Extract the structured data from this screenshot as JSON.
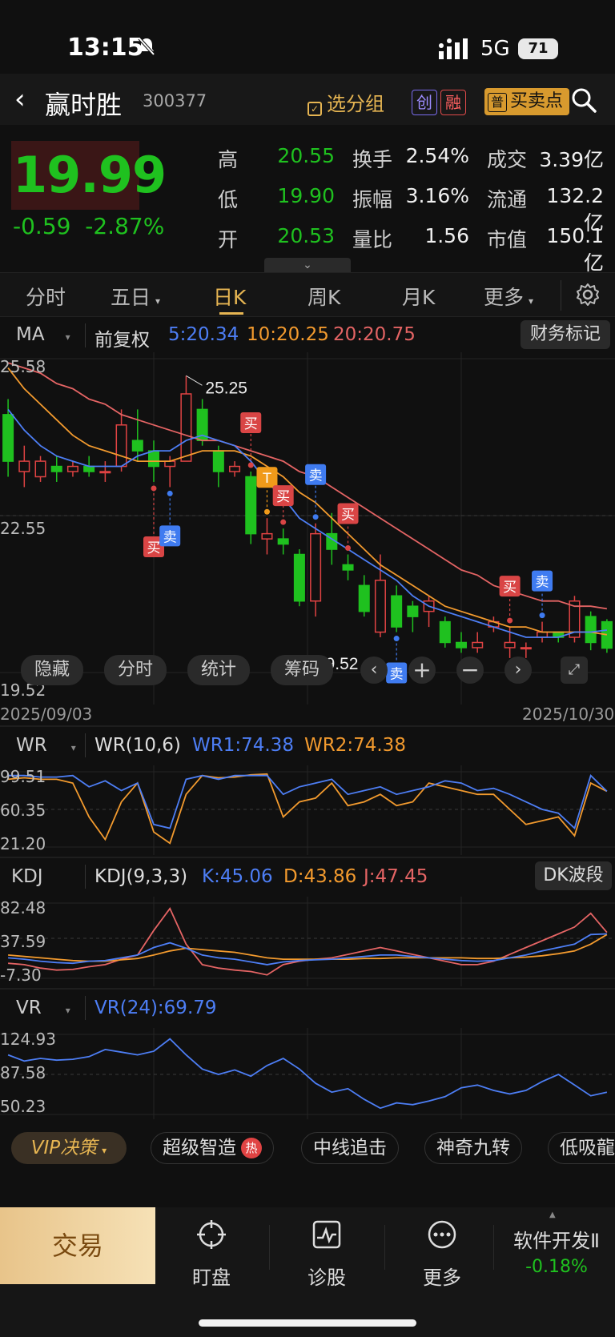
{
  "status_bar": {
    "time": "13:15",
    "network": "5G",
    "battery": "71"
  },
  "header": {
    "stock_name": "赢时胜",
    "stock_code": "300377",
    "group_button": "选分组",
    "tag_chuang": "创",
    "tag_rong": "融",
    "tag_pu": "普",
    "buy_sell_points": "买卖点"
  },
  "quote": {
    "price": "19.99",
    "change": "-0.59",
    "change_pct": "-2.87%",
    "high_label": "高",
    "high": "20.55",
    "low_label": "低",
    "low": "19.90",
    "open_label": "开",
    "open": "20.53",
    "turnover_label": "换手",
    "turnover": "2.54%",
    "amplitude_label": "振幅",
    "amplitude": "3.16%",
    "volume_ratio_label": "量比",
    "volume_ratio": "1.56",
    "amount_label": "成交",
    "amount": "3.39亿",
    "float_label": "流通",
    "float_cap": "132.2亿",
    "mktcap_label": "市值",
    "mktcap": "150.1亿"
  },
  "tabs": [
    "分时",
    "五日",
    "日K",
    "周K",
    "月K",
    "更多"
  ],
  "ma_bar": {
    "indicator": "MA",
    "adjust": "前复权",
    "ma5": "5:20.34",
    "ma10": "10:20.25",
    "ma20": "20:20.75",
    "financial_mark": "财务标记"
  },
  "chart_tools": [
    "隐藏",
    "分时",
    "统计",
    "筹码"
  ],
  "kline_axis": {
    "top": "25.58",
    "mid": "22.55",
    "bottom": "19.52",
    "start_date": "2025/09/03",
    "end_date": "2025/10/30",
    "high_mark": "25.25",
    "low_mark": "19.52"
  },
  "signals": {
    "buy": "买",
    "sell": "卖",
    "t": "T"
  },
  "wr": {
    "name": "WR",
    "params": "WR(10,6)",
    "wr1": "WR1:74.38",
    "wr2": "WR2:74.38",
    "ticks": [
      "99.51",
      "60.35",
      "21.20"
    ]
  },
  "kdj": {
    "name": "KDJ",
    "params": "KDJ(9,3,3)",
    "k": "K:45.06",
    "d": "D:43.86",
    "j": "J:47.45",
    "ticks": [
      "82.48",
      "37.59",
      "-7.30"
    ],
    "button": "DK波段"
  },
  "vr": {
    "name": "VR",
    "params": "VR(24):69.79",
    "ticks": [
      "124.93",
      "87.58",
      "50.23"
    ]
  },
  "strategy_chips": {
    "vip": "VIP决策",
    "items": [
      "超级智造",
      "中线追击",
      "神奇九转",
      "低吸龍"
    ],
    "hot": "热"
  },
  "bottom_nav": {
    "trade": "交易",
    "items": [
      "盯盘",
      "诊股",
      "更多"
    ],
    "sector_name": "软件开发Ⅱ",
    "sector_change": "-0.18%"
  },
  "colors": {
    "up": "#e04343",
    "down": "#1fc11f",
    "ma5": "#4d7ef5",
    "ma10": "#f29a2e",
    "ma20": "#e46464",
    "gold": "#e6b552"
  },
  "chart_data": {
    "type": "candlestick",
    "title": "",
    "y_range": [
      19.52,
      25.58
    ],
    "candles": [
      {
        "o": 24.5,
        "c": 23.6,
        "h": 24.8,
        "l": 23.3
      },
      {
        "o": 23.4,
        "c": 23.6,
        "h": 23.9,
        "l": 23.1
      },
      {
        "o": 23.3,
        "c": 23.6,
        "h": 23.7,
        "l": 23.2
      },
      {
        "o": 23.5,
        "c": 23.4,
        "h": 23.7,
        "l": 23.2
      },
      {
        "o": 23.4,
        "c": 23.5,
        "h": 23.6,
        "l": 23.3
      },
      {
        "o": 23.5,
        "c": 23.4,
        "h": 23.7,
        "l": 23.3
      },
      {
        "o": 23.4,
        "c": 23.4,
        "h": 23.6,
        "l": 23.2
      },
      {
        "o": 23.5,
        "c": 24.3,
        "h": 24.6,
        "l": 23.4
      },
      {
        "o": 24.0,
        "c": 23.8,
        "h": 24.6,
        "l": 23.6
      },
      {
        "o": 23.8,
        "c": 23.5,
        "h": 24.0,
        "l": 23.2
      },
      {
        "o": 23.5,
        "c": 23.6,
        "h": 23.7,
        "l": 23.1
      },
      {
        "o": 23.6,
        "c": 24.9,
        "h": 25.25,
        "l": 23.6
      },
      {
        "o": 24.6,
        "c": 24.0,
        "h": 24.8,
        "l": 23.9
      },
      {
        "o": 23.8,
        "c": 23.4,
        "h": 23.9,
        "l": 23.1
      },
      {
        "o": 23.4,
        "c": 23.5,
        "h": 23.6,
        "l": 23.3
      },
      {
        "o": 23.3,
        "c": 22.2,
        "h": 23.4,
        "l": 22.0
      },
      {
        "o": 22.1,
        "c": 22.2,
        "h": 22.5,
        "l": 21.8
      },
      {
        "o": 22.1,
        "c": 22.0,
        "h": 22.3,
        "l": 21.8
      },
      {
        "o": 21.8,
        "c": 20.9,
        "h": 21.9,
        "l": 20.8
      },
      {
        "o": 20.9,
        "c": 22.2,
        "h": 22.4,
        "l": 20.6
      },
      {
        "o": 22.2,
        "c": 21.9,
        "h": 22.6,
        "l": 21.6
      },
      {
        "o": 21.6,
        "c": 21.5,
        "h": 21.8,
        "l": 21.3
      },
      {
        "o": 21.2,
        "c": 20.7,
        "h": 21.4,
        "l": 20.6
      },
      {
        "o": 20.3,
        "c": 21.3,
        "h": 21.8,
        "l": 20.2
      },
      {
        "o": 21.0,
        "c": 20.4,
        "h": 21.2,
        "l": 20.3
      },
      {
        "o": 20.8,
        "c": 20.6,
        "h": 20.9,
        "l": 20.3
      },
      {
        "o": 20.7,
        "c": 20.9,
        "h": 21.0,
        "l": 20.4
      },
      {
        "o": 20.5,
        "c": 20.1,
        "h": 20.6,
        "l": 20.0
      },
      {
        "o": 20.1,
        "c": 20.0,
        "h": 20.3,
        "l": 19.9
      },
      {
        "o": 20.0,
        "c": 20.1,
        "h": 20.3,
        "l": 19.9
      },
      {
        "o": 20.4,
        "c": 20.5,
        "h": 20.6,
        "l": 20.3
      },
      {
        "o": 20.0,
        "c": 20.1,
        "h": 20.4,
        "l": 19.8
      },
      {
        "o": 20.0,
        "c": 20.0,
        "h": 20.1,
        "l": 19.8
      },
      {
        "o": 20.2,
        "c": 20.3,
        "h": 20.5,
        "l": 20.1
      },
      {
        "o": 20.3,
        "c": 20.2,
        "h": 20.3,
        "l": 20.1
      },
      {
        "o": 20.2,
        "c": 20.9,
        "h": 21.0,
        "l": 20.1
      },
      {
        "o": 20.6,
        "c": 20.1,
        "h": 20.7,
        "l": 19.95
      },
      {
        "o": 20.5,
        "c": 19.99,
        "h": 20.55,
        "l": 19.9
      }
    ],
    "ma5": [
      24.6,
      24.2,
      23.9,
      23.7,
      23.6,
      23.5,
      23.5,
      23.5,
      23.7,
      23.8,
      23.8,
      24.0,
      24.1,
      24.0,
      23.9,
      23.6,
      23.2,
      22.9,
      22.5,
      22.3,
      22.1,
      21.9,
      21.7,
      21.5,
      21.3,
      21.0,
      20.8,
      20.7,
      20.6,
      20.5,
      20.4,
      20.3,
      20.2,
      20.2,
      20.2,
      20.3,
      20.3,
      20.34
    ],
    "ma10": [
      25.4,
      25.0,
      24.7,
      24.4,
      24.1,
      23.9,
      23.8,
      23.7,
      23.6,
      23.6,
      23.6,
      23.7,
      23.8,
      23.8,
      23.8,
      23.7,
      23.5,
      23.3,
      23.0,
      22.8,
      22.5,
      22.2,
      21.9,
      21.6,
      21.4,
      21.2,
      21.0,
      20.8,
      20.7,
      20.6,
      20.5,
      20.4,
      20.4,
      20.3,
      20.3,
      20.3,
      20.3,
      20.25
    ],
    "ma20": [
      25.5,
      25.4,
      25.3,
      25.1,
      25.0,
      24.8,
      24.7,
      24.5,
      24.4,
      24.3,
      24.2,
      24.1,
      24.0,
      24.0,
      23.9,
      23.8,
      23.7,
      23.6,
      23.4,
      23.3,
      23.1,
      22.9,
      22.7,
      22.5,
      22.3,
      22.1,
      21.9,
      21.7,
      21.5,
      21.4,
      21.2,
      21.1,
      21.0,
      20.9,
      20.9,
      20.8,
      20.8,
      20.75
    ],
    "wr1": [
      95,
      95,
      93,
      93,
      95,
      80,
      88,
      75,
      85,
      30,
      25,
      90,
      95,
      90,
      95,
      95,
      95,
      70,
      80,
      85,
      90,
      70,
      75,
      80,
      70,
      75,
      80,
      88,
      85,
      75,
      78,
      70,
      60,
      50,
      45,
      25,
      95,
      74
    ],
    "wr2": [
      90,
      92,
      90,
      90,
      85,
      40,
      10,
      60,
      85,
      20,
      5,
      70,
      95,
      92,
      93,
      96,
      97,
      40,
      60,
      65,
      85,
      55,
      60,
      70,
      55,
      60,
      85,
      80,
      75,
      70,
      70,
      50,
      30,
      35,
      40,
      15,
      85,
      74
    ],
    "kdj_k": [
      10,
      8,
      5,
      3,
      2,
      5,
      6,
      10,
      14,
      25,
      32,
      24,
      14,
      10,
      8,
      4,
      0,
      4,
      6,
      7,
      8,
      10,
      12,
      14,
      14,
      12,
      10,
      8,
      6,
      5,
      6,
      10,
      14,
      20,
      25,
      30,
      44,
      45
    ],
    "kdj_d": [
      14,
      12,
      10,
      8,
      6,
      5,
      5,
      7,
      9,
      14,
      20,
      24,
      22,
      20,
      18,
      14,
      10,
      8,
      8,
      8,
      8,
      8,
      9,
      9,
      10,
      10,
      10,
      10,
      10,
      9,
      9,
      10,
      11,
      13,
      16,
      20,
      30,
      44
    ],
    "kdj_j": [
      2,
      0,
      -5,
      -8,
      -7,
      -3,
      0,
      8,
      14,
      50,
      82,
      30,
      0,
      -5,
      -8,
      -10,
      -15,
      0,
      5,
      8,
      10,
      15,
      20,
      25,
      20,
      15,
      10,
      5,
      0,
      0,
      5,
      15,
      25,
      35,
      45,
      55,
      75,
      47
    ],
    "vr": [
      112,
      105,
      108,
      106,
      107,
      110,
      118,
      115,
      112,
      116,
      130,
      112,
      96,
      90,
      95,
      88,
      100,
      108,
      96,
      80,
      70,
      74,
      62,
      52,
      58,
      56,
      60,
      65,
      75,
      78,
      72,
      68,
      72,
      82,
      90,
      78,
      66,
      70
    ]
  }
}
